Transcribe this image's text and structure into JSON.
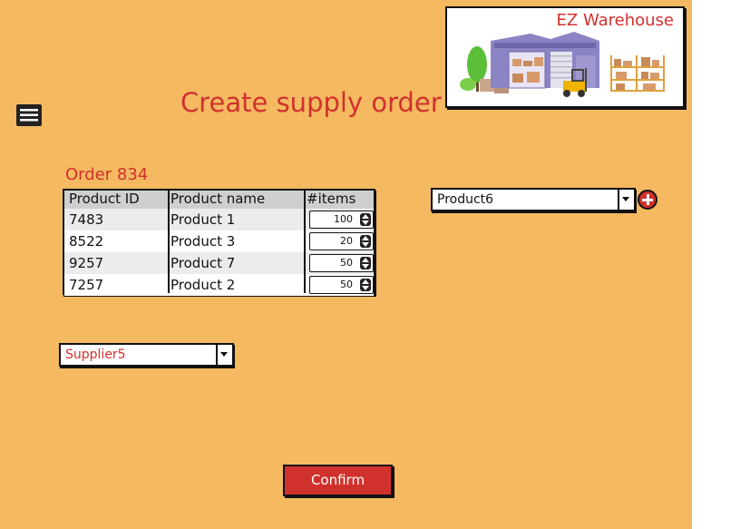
{
  "app": {
    "name": "EZ Warehouse"
  },
  "page": {
    "title": "Create supply order"
  },
  "order": {
    "label": "Order 834",
    "columns": [
      "Product ID",
      "Product name",
      "#items"
    ],
    "rows": [
      {
        "product_id": "7483",
        "product_name": "Product 1",
        "items": "100"
      },
      {
        "product_id": "8522",
        "product_name": "Product 3",
        "items": "20"
      },
      {
        "product_id": "9257",
        "product_name": "Product 7",
        "items": "50"
      },
      {
        "product_id": "7257",
        "product_name": "Product 2",
        "items": "50"
      }
    ]
  },
  "product_select": {
    "value": "Product6"
  },
  "supplier_select": {
    "value": "Supplier5"
  },
  "actions": {
    "confirm_label": "Confirm"
  },
  "colors": {
    "background": "#f4b961",
    "accent": "#d0312d"
  },
  "icons": {
    "menu": "menu-icon",
    "add": "plus-circle-icon",
    "logo": "warehouse-illustration"
  }
}
